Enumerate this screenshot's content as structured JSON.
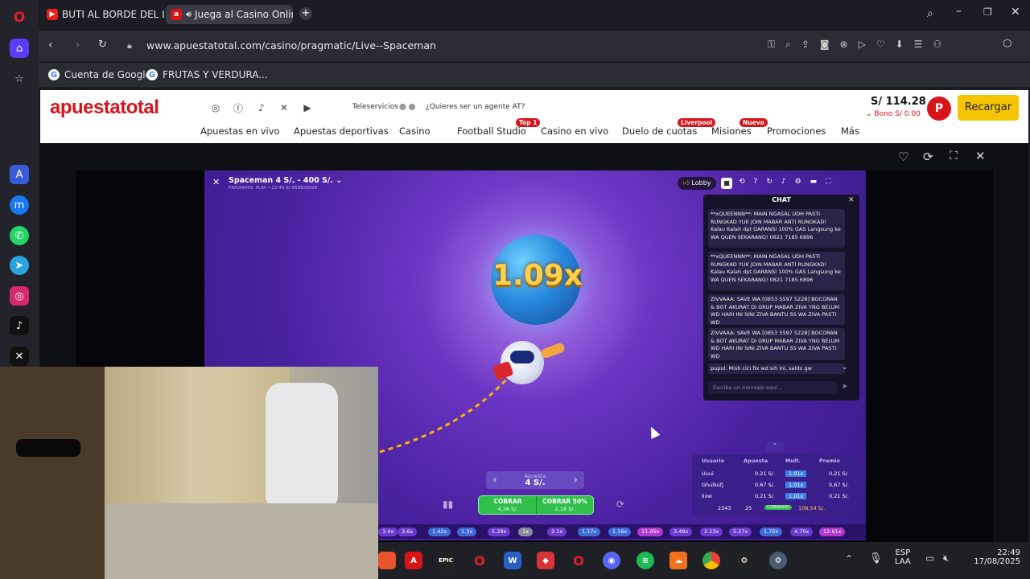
{
  "browser": {
    "tabs": [
      {
        "label": "BUTI AL BORDE DEL LLAN"
      },
      {
        "label": "Juega al Casino Online"
      }
    ],
    "url": "www.apuestatotal.com/casino/pragmatic/Live--Spaceman",
    "bookmarks": [
      {
        "label": "Cuenta de Google"
      },
      {
        "label": "FRUTAS Y VERDURA..."
      }
    ]
  },
  "site": {
    "logo": "apuestatotal",
    "teleservicios": "Teleservicios",
    "agent_prompt": "¿Quieres ser un agente AT?",
    "balance": "S/ 114.28",
    "bonus": "Bono S/ 0.00",
    "avatar_letter": "P",
    "recharge_label": "Recargar",
    "nav": [
      {
        "label": "Apuestas en vivo",
        "badge": ""
      },
      {
        "label": "Apuestas deportivas",
        "badge": ""
      },
      {
        "label": "Casino",
        "badge": ""
      },
      {
        "label": "Football Studio",
        "badge": "Top 1"
      },
      {
        "label": "Casino en vivo",
        "badge": ""
      },
      {
        "label": "Duelo de cuotas",
        "badge": "Liverpool"
      },
      {
        "label": "Misiones",
        "badge": "Nuevo"
      },
      {
        "label": "Promociones",
        "badge": ""
      },
      {
        "label": "Más",
        "badge": ""
      }
    ]
  },
  "game": {
    "title": "Spaceman 4 S/. - 400 S/.",
    "subtitle": "PRAGMATIC PLAY • 22:49 ID:958828020",
    "lobby_label": "Lobby",
    "multiplier": "1.09x",
    "bet_label": "Apuesta",
    "bet_value": "4 S/.",
    "cashout_label": "COBRAR",
    "cashout_value": "4,36 S/.",
    "cashout50_label": "COBRAR 50%",
    "cashout50_value": "2,18 S/."
  },
  "chat": {
    "title": "CHAT",
    "messages": [
      {
        "text": "**xQUEENNN**: MAIN NGASAL UDH PASTI RUNGKAD YUK JOIN MABAR ANTI RUNGKAD! Kalau Kalah dpt GARANSI 100% GAS Langsung ke WA QUEN SEKARANG! 0821 7185 6896"
      },
      {
        "text": "**xQUEENNN**: MAIN NGASAL UDH PASTI RUNGKAD YUK JOIN MABAR ANTI RUNGKAD! Kalau Kalah dpt GARANSI 100% GAS Langsung ke WA QUEN SEKARANG! 0821 7185 6896"
      },
      {
        "text": "ZIVVAAA: SAVE WA [0853 5597 5228] BOCORAN & BOT AKURAT DI GRUP MABAR ZIVA YNG BELUM WD HARI INI SINI ZIVA BANTU SS WA ZIVA PASTI WD"
      },
      {
        "text": "ZIVVAAA: SAVE WA [0853 5597 5228] BOCORAN & BOT AKURAT DI GRUP MABAR ZIVA YNG BELUM WD HARI INI SINI ZIVA BANTU SS WA ZIVA PASTI WD"
      },
      {
        "text": "pupul: Mish cici fix wd sih ini, saldo gw"
      }
    ],
    "input_placeholder": "Escriba un mensaje aquí..."
  },
  "bets": {
    "headers": [
      "Usuario",
      "Apuesta",
      "Mult.",
      "Premio"
    ],
    "rows": [
      {
        "user": "Uuui",
        "bet": "0,21 S/.",
        "mult": "1.01x",
        "prize": "0,21 S/."
      },
      {
        "user": "Ghulkufj",
        "bet": "0,67 S/.",
        "mult": "1.01x",
        "prize": "0,67 S/."
      },
      {
        "user": "liow",
        "bet": "0,21 S/.",
        "mult": "1.01x",
        "prize": "0,21 S/."
      }
    ],
    "players": "2343",
    "cashed": "25",
    "cashed_label": "COBRADO",
    "total": "108,54 S/."
  },
  "history": [
    "3.4x",
    "3.6x",
    "1.42x",
    "1.3x",
    "5.29x",
    "1x",
    "2.1x",
    "1.17x",
    "1.16x",
    "11.05x",
    "3.49x",
    "2.13x",
    "5.27x",
    "1.72x",
    "4.70x",
    "12.61x"
  ],
  "taskbar": {
    "language": "ESP",
    "layout": "LAA",
    "time": "22:49",
    "date": "17/08/2025"
  },
  "colors": {
    "brand_red": "#d7141a",
    "recharge_yellow": "#f6c400",
    "cashout_green": "#2fbf4a",
    "game_purple": "#5a2ab8"
  }
}
